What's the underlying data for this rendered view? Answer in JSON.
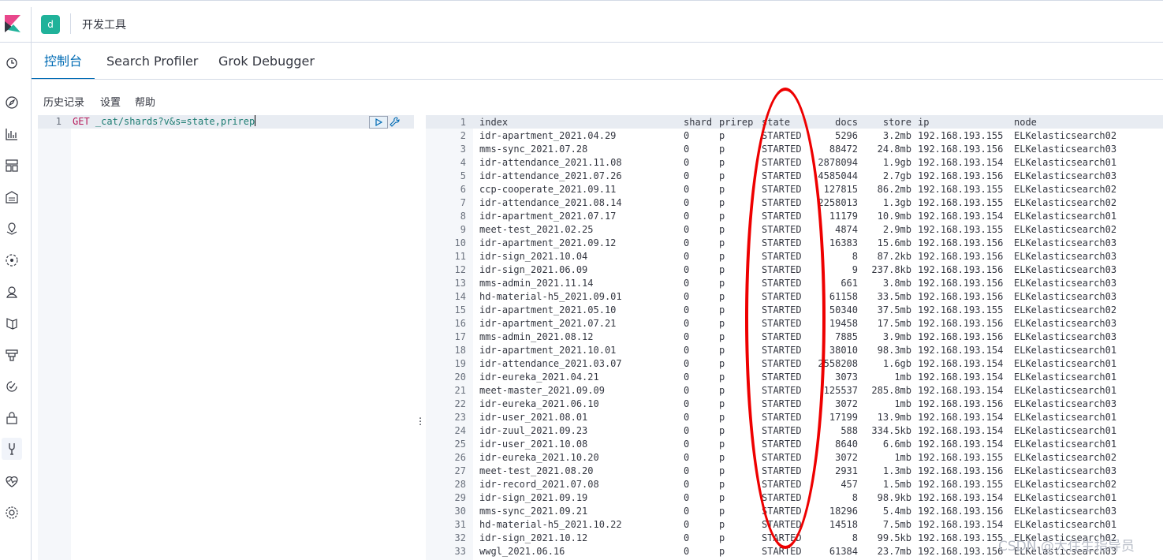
{
  "header": {
    "space_initial": "d",
    "breadcrumb": "开发工具",
    "brand_color": "#e8478b",
    "space_color": "#20b29a"
  },
  "tabs": [
    {
      "label": "控制台",
      "selected": true
    },
    {
      "label": "Search Profiler",
      "selected": false
    },
    {
      "label": "Grok Debugger",
      "selected": false
    }
  ],
  "menu": {
    "history": "历史记录",
    "settings": "设置",
    "help": "帮助"
  },
  "sidenav": [
    {
      "icon": "clock-icon"
    },
    {
      "icon": "compass-icon"
    },
    {
      "icon": "visualize-icon"
    },
    {
      "icon": "dashboard-icon"
    },
    {
      "icon": "canvas-icon"
    },
    {
      "icon": "maps-icon"
    },
    {
      "icon": "ml-icon"
    },
    {
      "icon": "graph-icon"
    },
    {
      "icon": "siem-icon"
    },
    {
      "icon": "logs-icon"
    },
    {
      "icon": "uptime-icon"
    },
    {
      "icon": "security-icon"
    },
    {
      "icon": "dev-tools-icon",
      "active": true
    },
    {
      "icon": "monitoring-icon"
    },
    {
      "icon": "management-icon"
    }
  ],
  "editor": {
    "line_number": "1",
    "method": "GET",
    "path": "_cat/shards?v&s=state,prirep"
  },
  "output": {
    "header": {
      "ln": "1",
      "index": "index",
      "shard": "shard",
      "prirep": "prirep",
      "state": "state",
      "docs": "docs",
      "store": "store",
      "ip": "ip",
      "node": "node"
    },
    "rows": [
      {
        "ln": "2",
        "index": "idr-apartment_2021.04.29",
        "shard": "0",
        "prirep": "p",
        "state": "STARTED",
        "docs": "5296",
        "store": "3.2mb",
        "ip": "192.168.193.155",
        "node": "ELKelasticsearch02"
      },
      {
        "ln": "3",
        "index": "mms-sync_2021.07.28",
        "shard": "0",
        "prirep": "p",
        "state": "STARTED",
        "docs": "88472",
        "store": "24.8mb",
        "ip": "192.168.193.156",
        "node": "ELKelasticsearch03"
      },
      {
        "ln": "4",
        "index": "idr-attendance_2021.11.08",
        "shard": "0",
        "prirep": "p",
        "state": "STARTED",
        "docs": "2878094",
        "store": "1.9gb",
        "ip": "192.168.193.154",
        "node": "ELKelasticsearch01"
      },
      {
        "ln": "5",
        "index": "idr-attendance_2021.07.26",
        "shard": "0",
        "prirep": "p",
        "state": "STARTED",
        "docs": "4585044",
        "store": "2.7gb",
        "ip": "192.168.193.156",
        "node": "ELKelasticsearch03"
      },
      {
        "ln": "6",
        "index": "ccp-cooperate_2021.09.11",
        "shard": "0",
        "prirep": "p",
        "state": "STARTED",
        "docs": "127815",
        "store": "86.2mb",
        "ip": "192.168.193.155",
        "node": "ELKelasticsearch02"
      },
      {
        "ln": "7",
        "index": "idr-attendance_2021.08.14",
        "shard": "0",
        "prirep": "p",
        "state": "STARTED",
        "docs": "2258013",
        "store": "1.3gb",
        "ip": "192.168.193.155",
        "node": "ELKelasticsearch02"
      },
      {
        "ln": "8",
        "index": "idr-apartment_2021.07.17",
        "shard": "0",
        "prirep": "p",
        "state": "STARTED",
        "docs": "11179",
        "store": "10.9mb",
        "ip": "192.168.193.154",
        "node": "ELKelasticsearch01"
      },
      {
        "ln": "9",
        "index": "meet-test_2021.02.25",
        "shard": "0",
        "prirep": "p",
        "state": "STARTED",
        "docs": "4874",
        "store": "2.9mb",
        "ip": "192.168.193.155",
        "node": "ELKelasticsearch02"
      },
      {
        "ln": "10",
        "index": "idr-apartment_2021.09.12",
        "shard": "0",
        "prirep": "p",
        "state": "STARTED",
        "docs": "16383",
        "store": "15.6mb",
        "ip": "192.168.193.156",
        "node": "ELKelasticsearch03"
      },
      {
        "ln": "11",
        "index": "idr-sign_2021.10.04",
        "shard": "0",
        "prirep": "p",
        "state": "STARTED",
        "docs": "8",
        "store": "87.2kb",
        "ip": "192.168.193.156",
        "node": "ELKelasticsearch03"
      },
      {
        "ln": "12",
        "index": "idr-sign_2021.06.09",
        "shard": "0",
        "prirep": "p",
        "state": "STARTED",
        "docs": "9",
        "store": "237.8kb",
        "ip": "192.168.193.156",
        "node": "ELKelasticsearch03"
      },
      {
        "ln": "13",
        "index": "mms-admin_2021.11.14",
        "shard": "0",
        "prirep": "p",
        "state": "STARTED",
        "docs": "661",
        "store": "3.8mb",
        "ip": "192.168.193.156",
        "node": "ELKelasticsearch03"
      },
      {
        "ln": "14",
        "index": "hd-material-h5_2021.09.01",
        "shard": "0",
        "prirep": "p",
        "state": "STARTED",
        "docs": "61158",
        "store": "33.5mb",
        "ip": "192.168.193.156",
        "node": "ELKelasticsearch03"
      },
      {
        "ln": "15",
        "index": "idr-apartment_2021.05.10",
        "shard": "0",
        "prirep": "p",
        "state": "STARTED",
        "docs": "50340",
        "store": "37.5mb",
        "ip": "192.168.193.155",
        "node": "ELKelasticsearch02"
      },
      {
        "ln": "16",
        "index": "idr-apartment_2021.07.21",
        "shard": "0",
        "prirep": "p",
        "state": "STARTED",
        "docs": "19458",
        "store": "17.5mb",
        "ip": "192.168.193.156",
        "node": "ELKelasticsearch03"
      },
      {
        "ln": "17",
        "index": "mms-admin_2021.08.12",
        "shard": "0",
        "prirep": "p",
        "state": "STARTED",
        "docs": "7885",
        "store": "3.9mb",
        "ip": "192.168.193.156",
        "node": "ELKelasticsearch03"
      },
      {
        "ln": "18",
        "index": "idr-apartment_2021.10.01",
        "shard": "0",
        "prirep": "p",
        "state": "STARTED",
        "docs": "38010",
        "store": "98.3mb",
        "ip": "192.168.193.154",
        "node": "ELKelasticsearch01"
      },
      {
        "ln": "19",
        "index": "idr-attendance_2021.03.07",
        "shard": "0",
        "prirep": "p",
        "state": "STARTED",
        "docs": "2558208",
        "store": "1.6gb",
        "ip": "192.168.193.154",
        "node": "ELKelasticsearch01"
      },
      {
        "ln": "20",
        "index": "idr-eureka_2021.04.21",
        "shard": "0",
        "prirep": "p",
        "state": "STARTED",
        "docs": "3073",
        "store": "1mb",
        "ip": "192.168.193.154",
        "node": "ELKelasticsearch01"
      },
      {
        "ln": "21",
        "index": "meet-master_2021.09.09",
        "shard": "0",
        "prirep": "p",
        "state": "STARTED",
        "docs": "125537",
        "store": "285.8mb",
        "ip": "192.168.193.154",
        "node": "ELKelasticsearch01"
      },
      {
        "ln": "22",
        "index": "idr-eureka_2021.06.10",
        "shard": "0",
        "prirep": "p",
        "state": "STARTED",
        "docs": "3072",
        "store": "1mb",
        "ip": "192.168.193.156",
        "node": "ELKelasticsearch03"
      },
      {
        "ln": "23",
        "index": "idr-user_2021.08.01",
        "shard": "0",
        "prirep": "p",
        "state": "STARTED",
        "docs": "17199",
        "store": "13.9mb",
        "ip": "192.168.193.154",
        "node": "ELKelasticsearch01"
      },
      {
        "ln": "24",
        "index": "idr-zuul_2021.09.23",
        "shard": "0",
        "prirep": "p",
        "state": "STARTED",
        "docs": "588",
        "store": "334.5kb",
        "ip": "192.168.193.154",
        "node": "ELKelasticsearch01"
      },
      {
        "ln": "25",
        "index": "idr-user_2021.10.08",
        "shard": "0",
        "prirep": "p",
        "state": "STARTED",
        "docs": "8640",
        "store": "6.6mb",
        "ip": "192.168.193.154",
        "node": "ELKelasticsearch01"
      },
      {
        "ln": "26",
        "index": "idr-eureka_2021.10.20",
        "shard": "0",
        "prirep": "p",
        "state": "STARTED",
        "docs": "3072",
        "store": "1mb",
        "ip": "192.168.193.155",
        "node": "ELKelasticsearch02"
      },
      {
        "ln": "27",
        "index": "meet-test_2021.08.20",
        "shard": "0",
        "prirep": "p",
        "state": "STARTED",
        "docs": "2931",
        "store": "1.3mb",
        "ip": "192.168.193.156",
        "node": "ELKelasticsearch03"
      },
      {
        "ln": "28",
        "index": "idr-record_2021.07.08",
        "shard": "0",
        "prirep": "p",
        "state": "STARTED",
        "docs": "457",
        "store": "1.5mb",
        "ip": "192.168.193.155",
        "node": "ELKelasticsearch02"
      },
      {
        "ln": "29",
        "index": "idr-sign_2021.09.19",
        "shard": "0",
        "prirep": "p",
        "state": "STARTED",
        "docs": "8",
        "store": "98.9kb",
        "ip": "192.168.193.154",
        "node": "ELKelasticsearch01"
      },
      {
        "ln": "30",
        "index": "mms-sync_2021.09.21",
        "shard": "0",
        "prirep": "p",
        "state": "STARTED",
        "docs": "18296",
        "store": "5.4mb",
        "ip": "192.168.193.156",
        "node": "ELKelasticsearch03"
      },
      {
        "ln": "31",
        "index": "hd-material-h5_2021.10.22",
        "shard": "0",
        "prirep": "p",
        "state": "STARTED",
        "docs": "14518",
        "store": "7.5mb",
        "ip": "192.168.193.154",
        "node": "ELKelasticsearch01"
      },
      {
        "ln": "32",
        "index": "idr-sign_2021.10.12",
        "shard": "0",
        "prirep": "p",
        "state": "STARTED",
        "docs": "8",
        "store": "99.5kb",
        "ip": "192.168.193.155",
        "node": "ELKelasticsearch02"
      },
      {
        "ln": "33",
        "index": "wwgl_2021.06.16",
        "shard": "0",
        "prirep": "p",
        "state": "STARTED",
        "docs": "61384",
        "store": "23.7mb",
        "ip": "192.168.193.156",
        "node": "ELKelasticsearch03"
      }
    ]
  },
  "annotation": {
    "color": "#ee0000"
  },
  "watermark": "CSDN @大住生指导员"
}
